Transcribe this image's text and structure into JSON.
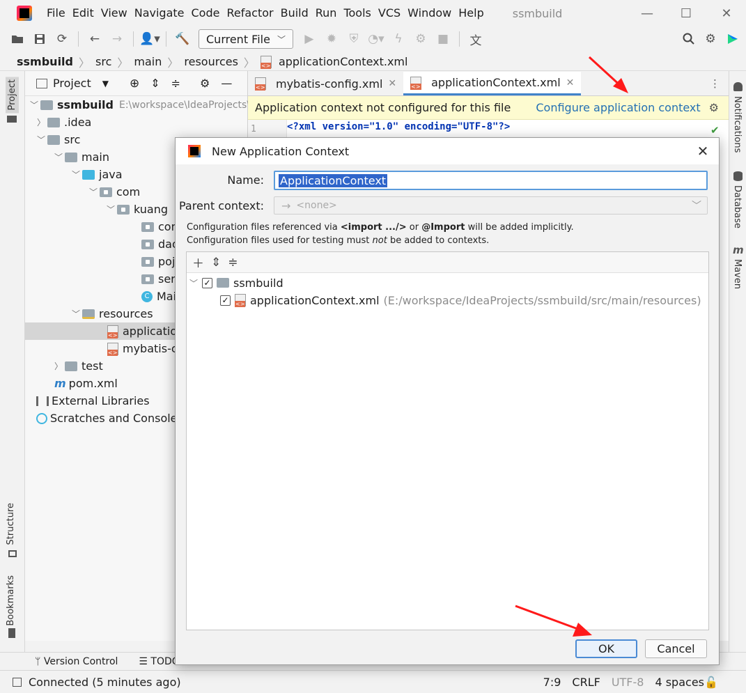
{
  "menubar": {
    "items": [
      "File",
      "Edit",
      "View",
      "Navigate",
      "Code",
      "Refactor",
      "Build",
      "Run",
      "Tools",
      "VCS",
      "Window",
      "Help"
    ],
    "project_title": "ssmbuild"
  },
  "toolbar": {
    "run_config": "Current File"
  },
  "breadcrumb": [
    "ssmbuild",
    "src",
    "main",
    "resources",
    "applicationContext.xml"
  ],
  "project_panel": {
    "title": "Project",
    "tree": {
      "root": "ssmbuild",
      "root_path": "E:\\workspace\\IdeaProjects\\ss",
      "idea": ".idea",
      "src": "src",
      "main": "main",
      "java": "java",
      "com": "com",
      "kuang": "kuang",
      "controller": "con",
      "dao": "dao",
      "pojo": "poj",
      "service": "serv",
      "main_class": "Mai",
      "resources": "resources",
      "app_ctx": "applicatior",
      "mybatis": "mybatis-co",
      "test": "test",
      "pom": "pom.xml",
      "ext_libs": "External Libraries",
      "scratches": "Scratches and Consoles"
    }
  },
  "left_tabs": {
    "project": "Project",
    "structure": "Structure",
    "bookmarks": "Bookmarks"
  },
  "right_tabs": {
    "notifications": "Notifications",
    "database": "Database",
    "maven": "Maven"
  },
  "editor": {
    "tabs": [
      {
        "label": "mybatis-config.xml"
      },
      {
        "label": "applicationContext.xml"
      }
    ],
    "banner_text": "Application context not configured for this file",
    "banner_link": "Configure application context",
    "line_number": "1",
    "code_line": "<?xml version=\"1.0\" encoding=\"UTF-8\"?>"
  },
  "dialog": {
    "title": "New Application Context",
    "name_label": "Name:",
    "name_value": "ApplicationContext",
    "parent_label": "Parent context:",
    "parent_value": "<none>",
    "hint1_a": "Configuration files referenced via ",
    "hint1_b": "<import .../>",
    "hint1_c": " or ",
    "hint1_d": "@Import",
    "hint1_e": " will be added implicitly.",
    "hint2_a": "Configuration files used for testing must ",
    "hint2_b": "not",
    "hint2_c": " be added to contexts.",
    "tree_module": "ssmbuild",
    "tree_file": "applicationContext.xml",
    "tree_file_path": "(E:/workspace/IdeaProjects/ssmbuild/src/main/resources)",
    "ok": "OK",
    "cancel": "Cancel"
  },
  "bottom_tabs": {
    "vcs": "Version Control",
    "todo": "TODO"
  },
  "status": {
    "message": "Connected (5 minutes ago)",
    "position": "7:9",
    "line_sep": "CRLF",
    "encoding": "UTF-8",
    "indent": "4 spaces"
  },
  "colors": {
    "accent": "#2470b3",
    "banner": "#fdfbd0",
    "selection": "#2f65ca",
    "arrow": "#ff1a1a"
  }
}
